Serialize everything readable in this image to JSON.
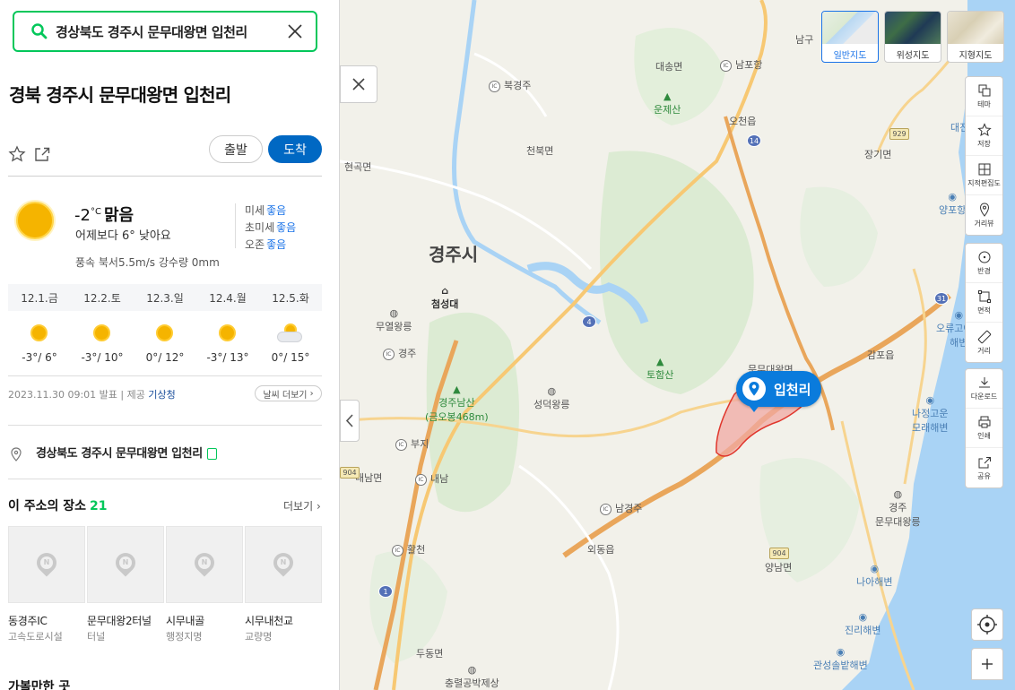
{
  "search": {
    "value": "경상북도 경주시 문무대왕면 입천리"
  },
  "place": {
    "title": "경북 경주시 문무대왕면 입천리"
  },
  "actions": {
    "start": "출발",
    "arrive": "도착"
  },
  "weather": {
    "temp": "-2",
    "unit": "°C",
    "condition": "맑음",
    "compare": "어제보다 6° 낮아요",
    "wind": "풍속 북서5.5m/s 강수량 0mm",
    "air": [
      {
        "label": "미세",
        "value": "좋음"
      },
      {
        "label": "초미세",
        "value": "좋음"
      },
      {
        "label": "오존",
        "value": "좋음"
      }
    ],
    "days": [
      {
        "date": "12.1.금",
        "low": "-3°",
        "high": "6°",
        "icon": "sun-icon"
      },
      {
        "date": "12.2.토",
        "low": "-3°",
        "high": "10°",
        "icon": "sun-icon"
      },
      {
        "date": "12.3.일",
        "low": "0°",
        "high": "12°",
        "icon": "sun-icon"
      },
      {
        "date": "12.4.월",
        "low": "-3°",
        "high": "13°",
        "icon": "sun-icon"
      },
      {
        "date": "12.5.화",
        "low": "0°",
        "high": "15°",
        "icon": "partly-cloudy-icon"
      }
    ],
    "issued": "2023.11.30 09:01 발표",
    "provider_label": "제공",
    "provider": "기상청",
    "more": "날씨 더보기"
  },
  "address": {
    "text": "경상북도 경주시 문무대왕면 입천리"
  },
  "places": {
    "title": "이 주소의 장소",
    "count": "21",
    "more": "더보기",
    "items": [
      {
        "name": "동경주IC",
        "category": "고속도로시설"
      },
      {
        "name": "문무대왕2터널",
        "category": "터널"
      },
      {
        "name": "시무내골",
        "category": "행정지명"
      },
      {
        "name": "시무내천교",
        "category": "교량명"
      }
    ]
  },
  "section2": {
    "title": "가볼만한 곳"
  },
  "map": {
    "marker": "입천리",
    "types": [
      {
        "label": "일반지도",
        "selected": true
      },
      {
        "label": "위성지도",
        "selected": false
      },
      {
        "label": "지형지도",
        "selected": false
      }
    ],
    "tools1": [
      "테마",
      "저장",
      "지적편집도",
      "거리뷰"
    ],
    "tools2": [
      "반경",
      "면적",
      "거리"
    ],
    "tools3": [
      "다운로드",
      "인쇄",
      "공유"
    ],
    "labels": {
      "gyeongju": "경주시",
      "daesin": "대송면",
      "ocheon": "오천읍",
      "cheonbuk": "천북면",
      "hyeongok": "현곡면",
      "janggi": "장기면",
      "gampo": "감포읍",
      "oedong": "외동읍",
      "yangnam": "양남면",
      "dudong": "두동면",
      "naenam": "내남면",
      "munmu_office": "문무대왕면",
      "unjesan": "운제산",
      "tohamsan": "토함산",
      "namsan": "경주남산\n(금오봉468m)",
      "cheomseongdae": "첨성대",
      "muyeol": "무열왕릉",
      "seongdeok": "성덕왕릉",
      "munmu_tomb": "경주\n문무대왕릉",
      "najeong": "나정고운\n모래해변",
      "oryu": "오류고아라\n해변",
      "naa": "나아해변",
      "jinri": "진리해변",
      "gwanseong": "관성솔밭해변",
      "yangpo": "양포항",
      "daejin": "대진간이해",
      "chunghyo": "충렬공박제상",
      "namgu": "남구",
      "ic_bukgj": "북경주",
      "ic_namhang": "남포항",
      "ic_gj": "경주",
      "ic_buji": "부지",
      "ic_naenam": "내남",
      "ic_namgj": "남경주",
      "ic_hwalcheon": "활천",
      "r14": "14",
      "r4": "4",
      "r31": "31",
      "r929": "929",
      "r904a": "904",
      "r904b": "904",
      "r1": "1"
    }
  }
}
